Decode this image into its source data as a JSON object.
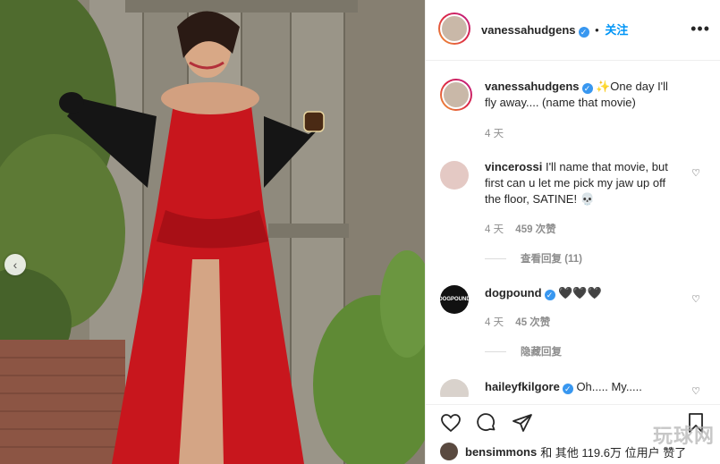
{
  "post": {
    "author": "vanessahudgens",
    "follow_label": "关注",
    "caption": "✨One day I'll fly away.... (name that movie)",
    "caption_time": "4 天"
  },
  "comments": [
    {
      "user": "vincerossi",
      "text": "I'll name that movie, but first can u let me pick my jaw up off the floor, SATINE! 💀",
      "time": "4 天",
      "likes": "459 次赞",
      "replies": "查看回复 (11)"
    },
    {
      "user": "dogpound",
      "verified": true,
      "text": "🖤🖤🖤",
      "time": "4 天",
      "likes": "45 次赞",
      "replies": "隐藏回复",
      "avatar_text": "DOGPOUND"
    },
    {
      "user": "haileyfkilgore",
      "verified": true,
      "text": "Oh..... My....."
    }
  ],
  "likes_line": {
    "user": "bensimmons",
    "rest": "和 其他 119.6万 位用户 赞了"
  },
  "watermark": "玩球网",
  "icons": {
    "verified": "verified-badge-icon",
    "more": "more-options-icon",
    "heart": "heart-icon",
    "comment": "comment-icon",
    "share": "share-icon",
    "save": "bookmark-icon",
    "carousel": "chevron-left-icon"
  },
  "colors": {
    "accent": "#0095f6",
    "verified": "#3897f0",
    "dress": "#c8161d"
  }
}
